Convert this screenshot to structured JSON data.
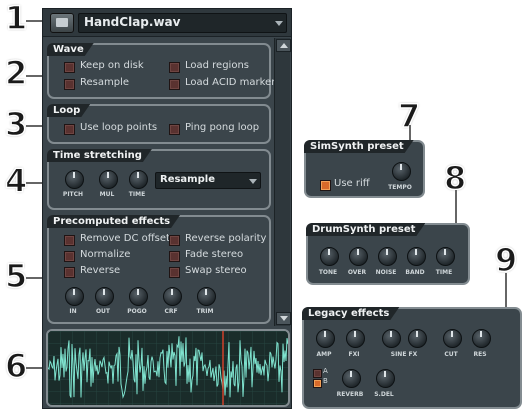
{
  "file": {
    "name": "HandClap.wav"
  },
  "wave": {
    "title": "Wave",
    "keep_on_disk": "Keep on disk",
    "resample": "Resample",
    "load_regions": "Load regions",
    "load_acid_markers": "Load ACID markers"
  },
  "loop": {
    "title": "Loop",
    "use_loop_points": "Use loop points",
    "ping_pong_loop": "Ping pong loop"
  },
  "time_stretching": {
    "title": "Time stretching",
    "knobs": [
      "PITCH",
      "MUL",
      "TIME"
    ],
    "mode": "Resample"
  },
  "precomputed": {
    "title": "Precomputed effects",
    "remove_dc_offset": "Remove DC offset",
    "normalize": "Normalize",
    "reverse": "Reverse",
    "reverse_polarity": "Reverse polarity",
    "fade_stereo": "Fade stereo",
    "swap_stereo": "Swap stereo",
    "knobs": [
      "IN",
      "OUT",
      "POGO",
      "CRF",
      "TRIM"
    ]
  },
  "simsynth": {
    "title": "SimSynth preset",
    "use_riff": "Use riff",
    "knob": "TEMPO"
  },
  "drumsynth": {
    "title": "DrumSynth preset",
    "knobs": [
      "TONE",
      "OVER",
      "NOISE",
      "BAND",
      "TIME"
    ]
  },
  "legacy": {
    "title": "Legacy effects",
    "knobs_top": [
      "AMP",
      "FXI",
      "SINE FX",
      "CUT",
      "RES"
    ],
    "ab": [
      "A",
      "B"
    ],
    "knobs_bottom": [
      "REVERB",
      "S.DEL"
    ]
  },
  "callouts": [
    "1",
    "2",
    "3",
    "4",
    "5",
    "6",
    "7",
    "8",
    "9"
  ],
  "colors": {
    "panel": "#3b454b",
    "border": "#828b90",
    "checkbox_on": "#d86a2a",
    "waveform": "#7fe3cf",
    "marker": "#d0402a"
  }
}
